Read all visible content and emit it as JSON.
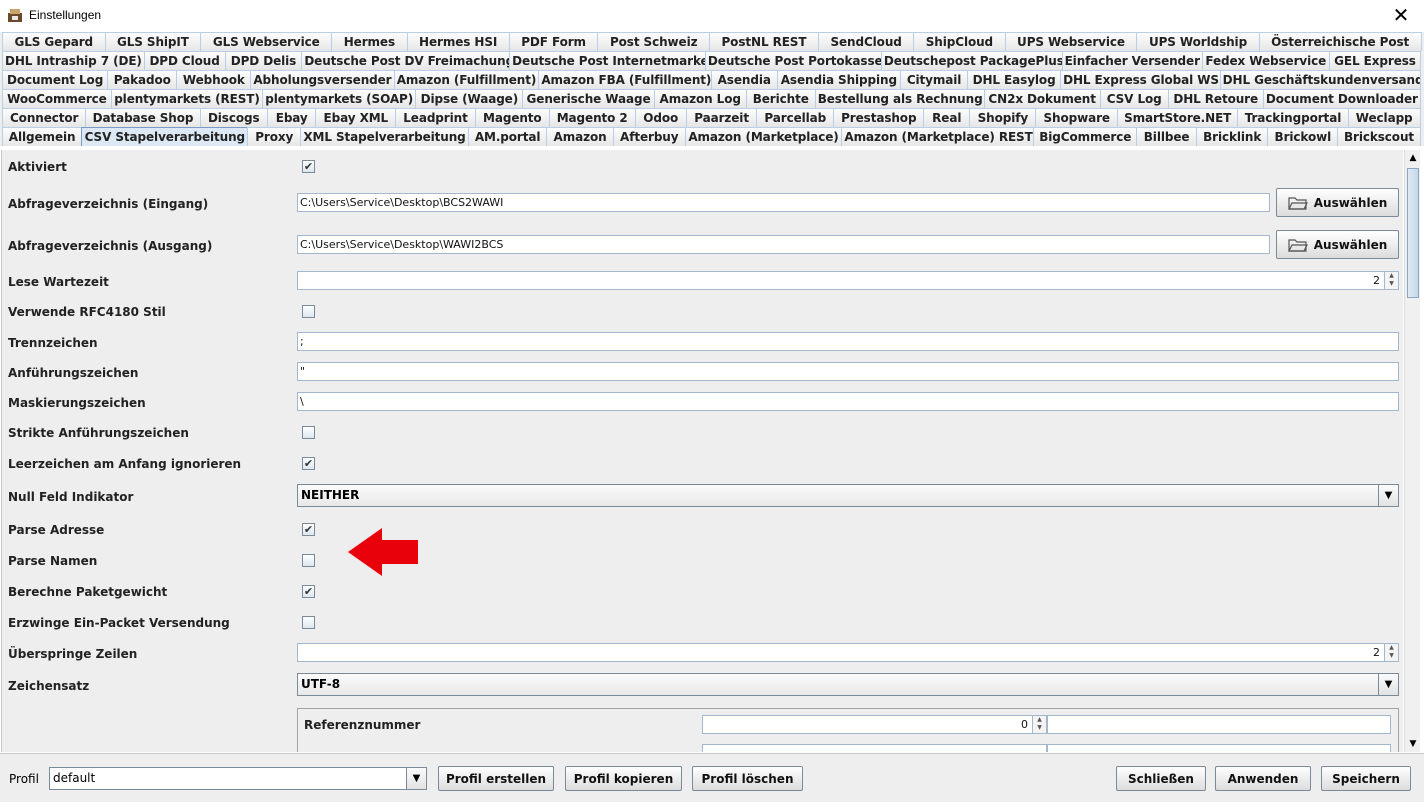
{
  "window": {
    "title": "Einstellungen",
    "close_glyph": "✕"
  },
  "tabs": {
    "row1": [
      "GLS Gepard",
      "GLS ShipIT",
      "GLS Webservice",
      "Hermes",
      "Hermes HSI",
      "PDF Form",
      "Post Schweiz",
      "PostNL REST",
      "SendCloud",
      "ShipCloud",
      "UPS Webservice",
      "UPS Worldship",
      "Österreichische Post"
    ],
    "row2": [
      "DHL Intraship 7 (DE)",
      "DPD Cloud",
      "DPD Delis",
      "Deutsche Post DV Freimachung",
      "Deutsche Post Internetmarke",
      "Deutsche Post Portokasse",
      "Deutschepost PackagePlus",
      "Einfacher Versender",
      "Fedex Webservice",
      "GEL Express"
    ],
    "row3": [
      "Document Log",
      "Pakadoo",
      "Webhook",
      "Abholungsversender",
      "Amazon (Fulfillment)",
      "Amazon FBA (Fulfillment)",
      "Asendia",
      "Asendia Shipping",
      "Citymail",
      "DHL Easylog",
      "DHL Express Global WS",
      "DHL Geschäftskundenversand"
    ],
    "row4": [
      "WooCommerce",
      "plentymarkets (REST)",
      "plentymarkets (SOAP)",
      "Dipse (Waage)",
      "Generische Waage",
      "Amazon Log",
      "Berichte",
      "Bestellung als Rechnung",
      "CN2x Dokument",
      "CSV Log",
      "DHL Retoure",
      "Document Downloader"
    ],
    "row5": [
      "Connector",
      "Database Shop",
      "Discogs",
      "Ebay",
      "Ebay XML",
      "Leadprint",
      "Magento",
      "Magento 2",
      "Odoo",
      "Paarzeit",
      "Parcellab",
      "Prestashop",
      "Real",
      "Shopify",
      "Shopware",
      "SmartStore.NET",
      "Trackingportal",
      "Weclapp"
    ],
    "row6": [
      "Allgemein",
      "CSV Stapelverarbeitung",
      "Proxy",
      "XML Stapelverarbeitung",
      "AM.portal",
      "Amazon",
      "Afterbuy",
      "Amazon (Marketplace)",
      "Amazon (Marketplace) REST",
      "BigCommerce",
      "Billbee",
      "Bricklink",
      "Brickowl",
      "Brickscout"
    ],
    "active": "CSV Stapelverarbeitung"
  },
  "form": {
    "aktiviert": {
      "label": "Aktiviert",
      "checked": "✔"
    },
    "eingang": {
      "label": "Abfrageverzeichnis (Eingang)",
      "value": "C:\\Users\\Service\\Desktop\\BCS2WAWI",
      "button": "Auswählen"
    },
    "ausgang": {
      "label": "Abfrageverzeichnis (Ausgang)",
      "value": "C:\\Users\\Service\\Desktop\\WAWI2BCS",
      "button": "Auswählen"
    },
    "lese_wartezeit": {
      "label": "Lese Wartezeit",
      "value": "2"
    },
    "rfc4180": {
      "label": "Verwende RFC4180 Stil",
      "checked": ""
    },
    "trennzeichen": {
      "label": "Trennzeichen",
      "value": ";"
    },
    "anfuehrungszeichen": {
      "label": "Anführungszeichen",
      "value": "\""
    },
    "maskierungszeichen": {
      "label": "Maskierungszeichen",
      "value": "\\"
    },
    "strikte": {
      "label": "Strikte Anführungszeichen",
      "checked": ""
    },
    "leerzeichen": {
      "label": "Leerzeichen am Anfang ignorieren",
      "checked": "✔"
    },
    "null_feld": {
      "label": "Null Feld Indikator",
      "value": "NEITHER"
    },
    "parse_adresse": {
      "label": "Parse Adresse",
      "checked": "✔"
    },
    "parse_namen": {
      "label": "Parse Namen",
      "checked": ""
    },
    "paketgewicht": {
      "label": "Berechne Paketgewicht",
      "checked": "✔"
    },
    "ein_packet": {
      "label": "Erzwinge Ein-Packet Versendung",
      "checked": ""
    },
    "ueberspringe": {
      "label": "Überspringe Zeilen",
      "value": "2"
    },
    "zeichensatz": {
      "label": "Zeichensatz",
      "value": "UTF-8"
    },
    "referenz": {
      "label": "Referenznummer",
      "value": "0"
    }
  },
  "bottom": {
    "profil_label": "Profil",
    "profil_value": "default",
    "erstellen": "Profil erstellen",
    "kopieren": "Profil kopieren",
    "loeschen": "Profil löschen",
    "schliessen": "Schließen",
    "anwenden": "Anwenden",
    "speichern": "Speichern"
  },
  "colors": {
    "annotation_arrow": "#e8000b",
    "active_tab": "#dce9f5"
  }
}
